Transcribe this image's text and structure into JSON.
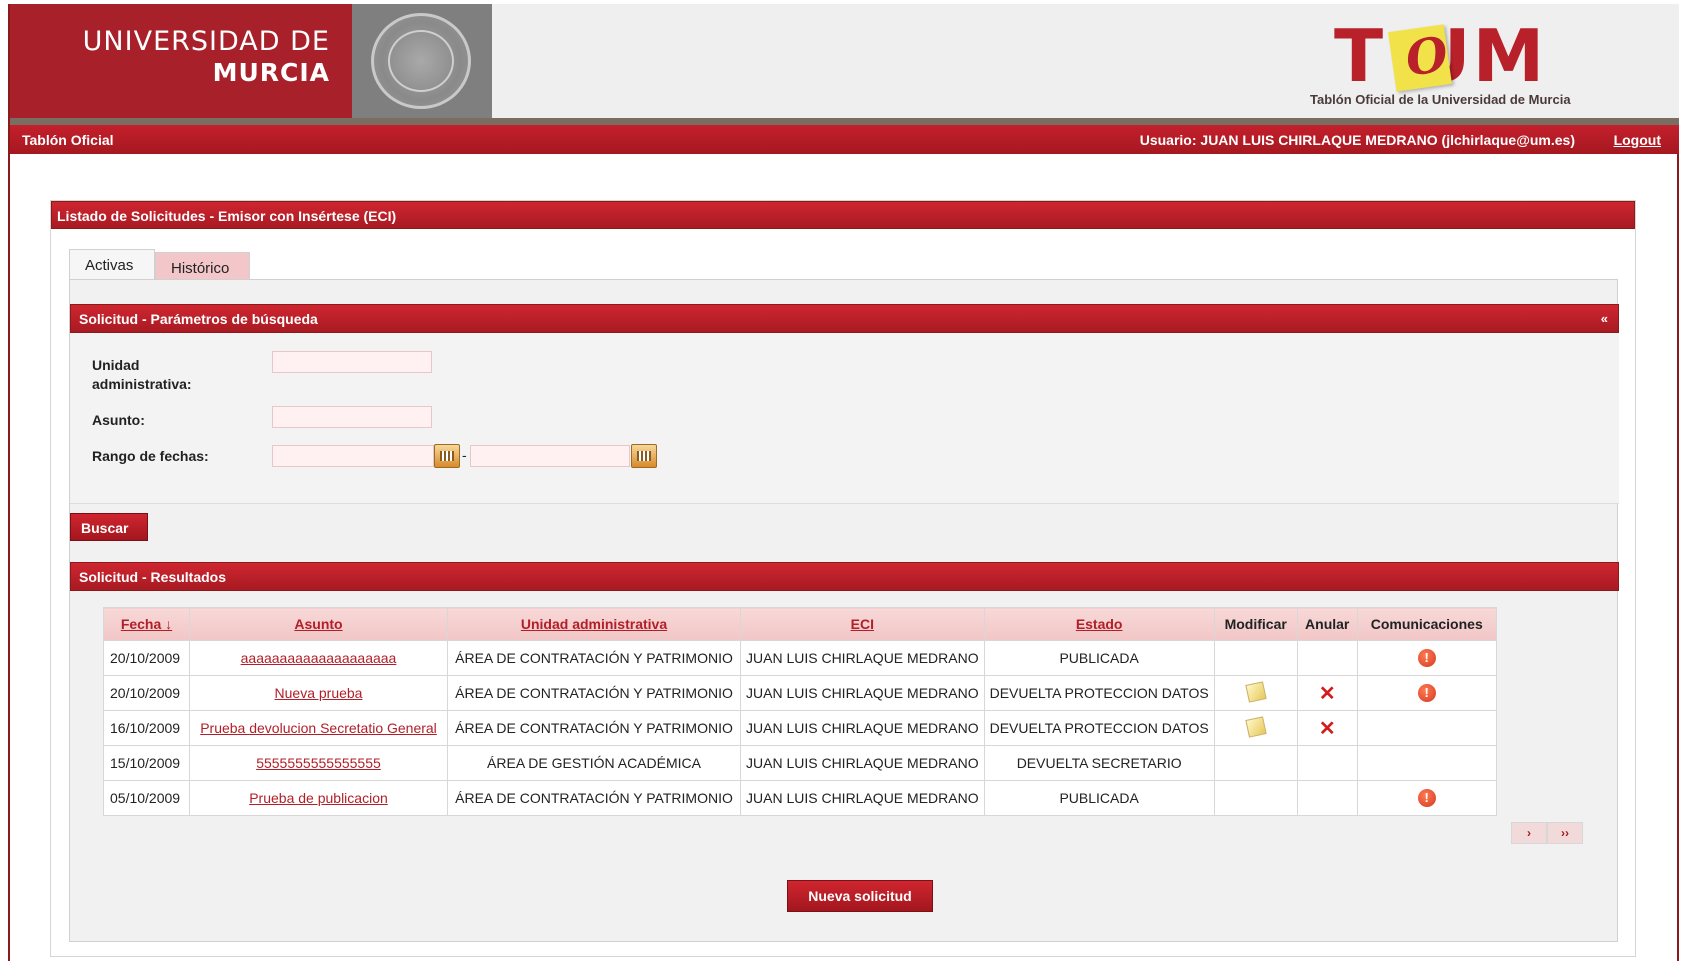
{
  "header": {
    "university_line1": "UNIVERSIDAD DE",
    "university_line2": "MURCIA",
    "brand_letters": "T UM",
    "brand_note_letter": "O",
    "brand_subtitle": "Tablón Oficial de la Universidad de Murcia"
  },
  "topbar": {
    "section": "Tablón Oficial",
    "user": "Usuario: JUAN LUIS CHIRLAQUE MEDRANO (jlchirlaque@um.es)",
    "logout": "Logout"
  },
  "page_title": "Listado de Solicitudes - Emisor con Insértese (ECI)",
  "tabs": [
    {
      "label": "Activas",
      "active": true
    },
    {
      "label": "Histórico",
      "active": false
    }
  ],
  "search": {
    "title": "Solicitud - Parámetros de búsqueda",
    "collapse": "«",
    "unidad_label_1": "Unidad",
    "unidad_label_2": "administrativa:",
    "unidad_value": "",
    "asunto_label": "Asunto:",
    "asunto_value": "",
    "rango_label": "Rango de fechas:",
    "fecha_desde": "",
    "fecha_hasta": "",
    "separator": "-",
    "buscar": "Buscar"
  },
  "results": {
    "title": "Solicitud - Resultados",
    "columns": [
      "Fecha ↓",
      "Asunto",
      "Unidad administrativa",
      "ECI",
      "Estado",
      "Modificar",
      "Anular",
      "Comunicaciones"
    ],
    "rows": [
      {
        "fecha": "20/10/2009",
        "asunto": "aaaaaaaaaaaaaaaaaaaa",
        "unidad": "ÁREA DE CONTRATACIÓN Y PATRIMONIO",
        "eci": "JUAN LUIS CHIRLAQUE MEDRANO",
        "estado": "PUBLICADA",
        "modificar": false,
        "anular": false,
        "comunicaciones": true
      },
      {
        "fecha": "20/10/2009",
        "asunto": "Nueva prueba",
        "unidad": "ÁREA DE CONTRATACIÓN Y PATRIMONIO",
        "eci": "JUAN LUIS CHIRLAQUE MEDRANO",
        "estado": "DEVUELTA PROTECCION DATOS",
        "modificar": true,
        "anular": true,
        "comunicaciones": true
      },
      {
        "fecha": "16/10/2009",
        "asunto": "Prueba devolucion Secretatio General",
        "unidad": "ÁREA DE CONTRATACIÓN Y PATRIMONIO",
        "eci": "JUAN LUIS CHIRLAQUE MEDRANO",
        "estado": "DEVUELTA PROTECCION DATOS",
        "modificar": true,
        "anular": true,
        "comunicaciones": false
      },
      {
        "fecha": "15/10/2009",
        "asunto": "5555555555555555",
        "unidad": "ÁREA DE GESTIÓN ACADÉMICA",
        "eci": "JUAN LUIS CHIRLAQUE MEDRANO",
        "estado": "DEVUELTA SECRETARIO",
        "modificar": false,
        "anular": false,
        "comunicaciones": false
      },
      {
        "fecha": "05/10/2009",
        "asunto": "Prueba de publicacion",
        "unidad": "ÁREA DE CONTRATACIÓN Y PATRIMONIO",
        "eci": "JUAN LUIS CHIRLAQUE MEDRANO",
        "estado": "PUBLICADA",
        "modificar": false,
        "anular": false,
        "comunicaciones": true
      }
    ],
    "pager_next": "›",
    "pager_last": "››",
    "nueva": "Nueva solicitud"
  },
  "icons": {
    "edit": "edit-icon",
    "delete": "x-icon",
    "warning": "warning-icon",
    "calendar": "calendar-icon"
  },
  "colors": {
    "brand_red": "#a8202a",
    "link_red": "#b21f28",
    "stripe": "#7a6e62"
  }
}
